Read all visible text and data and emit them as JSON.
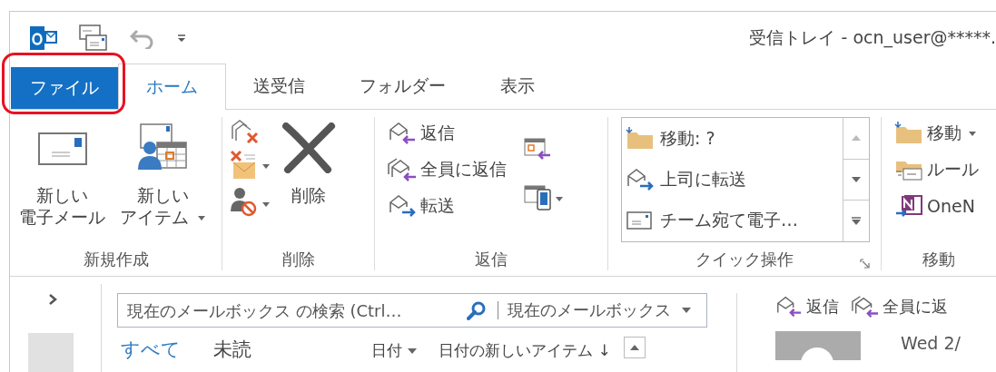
{
  "title": "受信トレイ - ocn_user@*****.",
  "tabs": [
    {
      "label": "ファイル",
      "kind": "file",
      "highlighted": true,
      "selected": false
    },
    {
      "label": "ホーム",
      "kind": "tab",
      "highlighted": false,
      "selected": true
    },
    {
      "label": "送受信",
      "kind": "tab",
      "highlighted": false,
      "selected": false
    },
    {
      "label": "フォルダー",
      "kind": "tab",
      "highlighted": false,
      "selected": false
    },
    {
      "label": "表示",
      "kind": "tab",
      "highlighted": false,
      "selected": false
    }
  ],
  "ribbon": {
    "new": {
      "label": "新規作成",
      "new_email": [
        "新しい",
        "電子メール"
      ],
      "new_items": [
        "新しい",
        "アイテム"
      ]
    },
    "delete": {
      "label": "削除",
      "delete_button": "削除"
    },
    "respond": {
      "label": "返信",
      "reply": "返信",
      "reply_all": "全員に返信",
      "forward": "転送"
    },
    "quick_steps": {
      "label": "クイック操作",
      "items": [
        {
          "label": "移動: ?",
          "kind": "folder"
        },
        {
          "label": "上司に転送",
          "kind": "forward"
        },
        {
          "label": "チーム宛て電子…",
          "kind": "mail"
        }
      ]
    },
    "move": {
      "label": "移動",
      "move": "移動",
      "rules": "ルール",
      "onenote": "OneN"
    }
  },
  "search": {
    "placeholder": "現在のメールボックス の検索 (Ctrl…",
    "scope": "現在のメールボックス"
  },
  "filters": [
    {
      "label": "すべて",
      "selected": true
    },
    {
      "label": "未読",
      "selected": false
    }
  ],
  "sort": {
    "by": "日付",
    "order": "日付の新しいアイテム ↓"
  },
  "reading_pane": {
    "reply": "返信",
    "reply_all": "全員に返",
    "date": "Wed 2/"
  }
}
